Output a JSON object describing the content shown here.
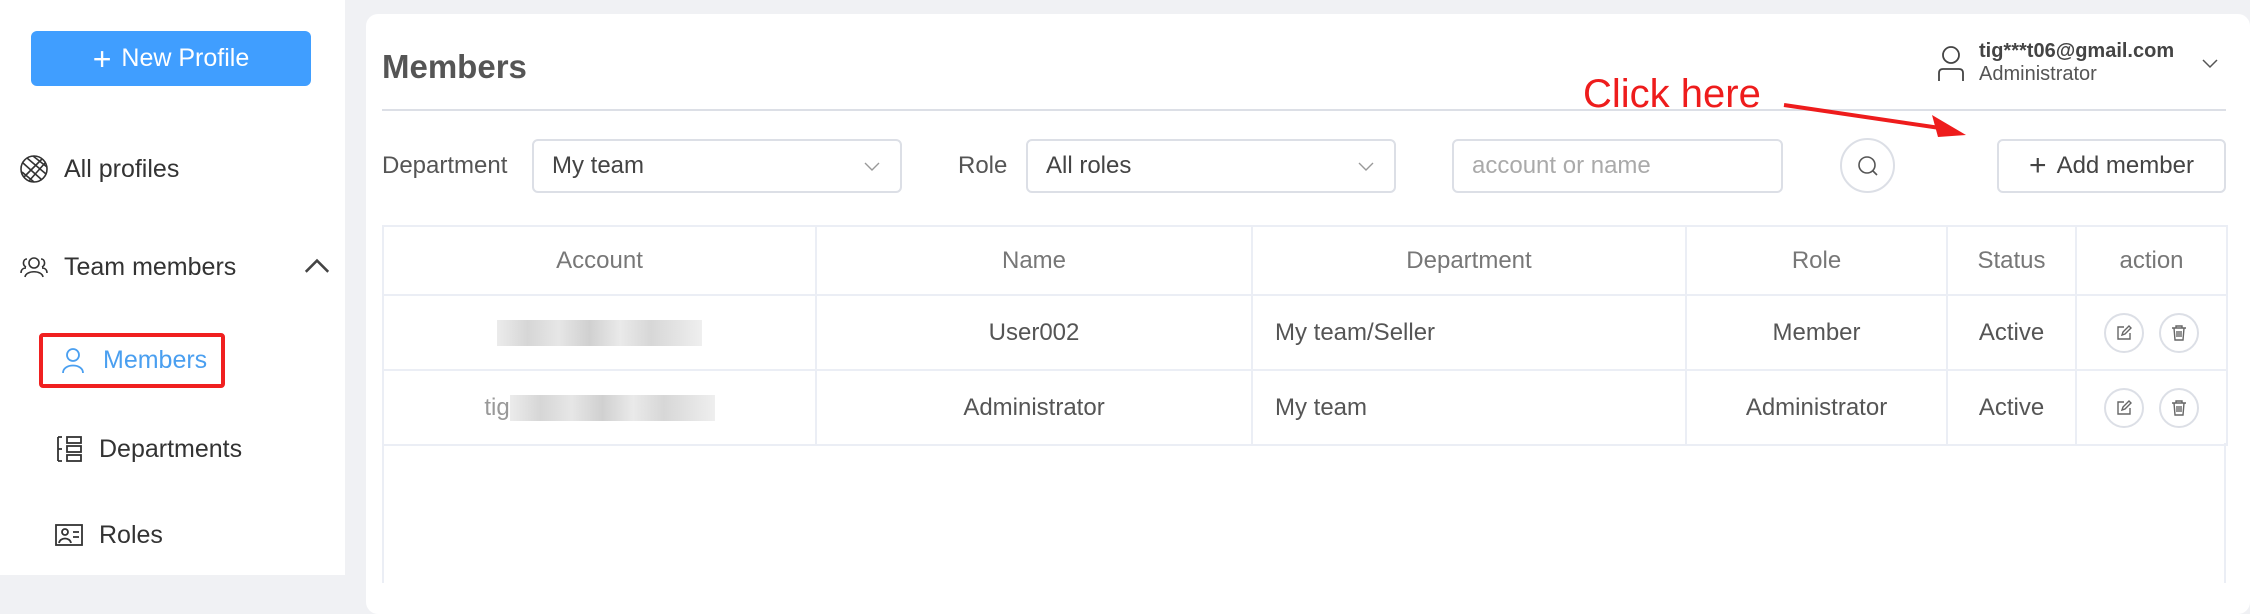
{
  "sidebar": {
    "new_profile_label": "New Profile",
    "items": [
      {
        "label": "All profiles",
        "icon": "globe-icon"
      },
      {
        "label": "Team members",
        "icon": "team-icon",
        "expanded": true
      },
      {
        "label": "Members",
        "icon": "user-icon",
        "active": true
      },
      {
        "label": "Departments",
        "icon": "departments-icon"
      },
      {
        "label": "Roles",
        "icon": "id-card-icon"
      }
    ]
  },
  "header": {
    "title": "Members",
    "user_email": "tig***t06@gmail.com",
    "user_role": "Administrator"
  },
  "annotation": {
    "text": "Click here",
    "color": "#ee1c1c"
  },
  "filters": {
    "department_label": "Department",
    "department_value": "My team",
    "role_label": "Role",
    "role_value": "All roles",
    "search_placeholder": "account or name",
    "add_member_label": "Add member"
  },
  "table": {
    "columns": [
      "Account",
      "Name",
      "Department",
      "Role",
      "Status",
      "action"
    ],
    "rows": [
      {
        "account": "",
        "name": "User002",
        "department": "My team/Seller",
        "role": "Member",
        "status": "Active"
      },
      {
        "account": "tig",
        "name": "Administrator",
        "department": "My team",
        "role": "Administrator",
        "status": "Active"
      }
    ]
  },
  "colors": {
    "accent": "#409eff",
    "active_nav": "#4a9ff0",
    "highlight_box": "#f02020"
  }
}
